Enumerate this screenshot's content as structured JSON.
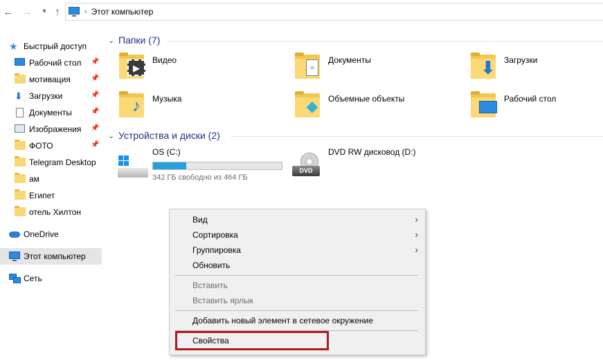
{
  "address_bar": {
    "crumb": "Этот компьютер"
  },
  "sidebar": {
    "quick_access": "Быстрый доступ",
    "items": [
      {
        "label": "Рабочий стол",
        "icon": "desktop-icon",
        "pinned": true
      },
      {
        "label": "мотивация",
        "icon": "folder-icon",
        "pinned": true
      },
      {
        "label": "Загрузки",
        "icon": "download-icon",
        "pinned": true
      },
      {
        "label": "Документы",
        "icon": "document-icon",
        "pinned": true
      },
      {
        "label": "Изображения",
        "icon": "pictures-icon",
        "pinned": true
      },
      {
        "label": "ФОТО",
        "icon": "folder-icon",
        "pinned": true
      },
      {
        "label": "Telegram Desktop",
        "icon": "folder-icon",
        "pinned": false
      },
      {
        "label": "ам",
        "icon": "folder-icon",
        "pinned": false
      },
      {
        "label": "Египет",
        "icon": "folder-icon",
        "pinned": false
      },
      {
        "label": "отель Хилтон",
        "icon": "folder-icon",
        "pinned": false
      }
    ],
    "onedrive": "OneDrive",
    "this_pc": "Этот компьютер",
    "network": "Сеть"
  },
  "main": {
    "folders_header": "Папки (7)",
    "folders": [
      {
        "name": "Видео",
        "icon": "video-folder-icon"
      },
      {
        "name": "Документы",
        "icon": "documents-folder-icon"
      },
      {
        "name": "Загрузки",
        "icon": "downloads-folder-icon"
      },
      {
        "name": "Музыка",
        "icon": "music-folder-icon"
      },
      {
        "name": "Объемные объекты",
        "icon": "3d-objects-folder-icon"
      },
      {
        "name": "Рабочий стол",
        "icon": "desktop-folder-icon"
      }
    ],
    "devices_header": "Устройства и диски (2)",
    "drives": [
      {
        "name": "OS (C:)",
        "free_text": "342 ГБ свободно из 464 ГБ",
        "used_fraction": 0.26,
        "icon": "windows-drive-icon"
      },
      {
        "name": "DVD RW дисковод (D:)",
        "icon": "dvd-drive-icon",
        "badge": "DVD"
      }
    ]
  },
  "context_menu": {
    "items": {
      "view": "Вид",
      "sort": "Сортировка",
      "group": "Группировка",
      "refresh": "Обновить",
      "paste": "Вставить",
      "paste_shortcut": "Вставить ярлык",
      "add_network": "Добавить новый элемент в сетевое окружение",
      "properties": "Свойства"
    }
  },
  "colors": {
    "accent": "#26a0da",
    "group_header": "#1e3287",
    "highlight_box": "#b2161f",
    "selected_nav": "#e5e5e5"
  }
}
